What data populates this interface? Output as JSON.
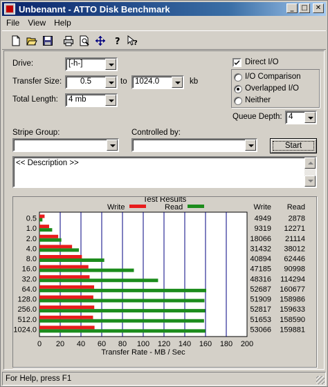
{
  "window": {
    "title": "Unbenannt - ATTO Disk Benchmark",
    "app_icon_text": "ATTO",
    "controls": {
      "minimize": "_",
      "maximize": "□",
      "close": "✕"
    }
  },
  "menu": [
    "File",
    "View",
    "Help"
  ],
  "toolbar": [
    "new-icon",
    "open-icon",
    "save-icon",
    "print-icon",
    "print-preview-icon",
    "move-icon",
    "help-icon",
    "context-help-icon"
  ],
  "form": {
    "drive": {
      "label": "Drive:",
      "value": "[-h-]"
    },
    "transfer_size": {
      "label": "Transfer Size:",
      "from": "0.5",
      "to_label": "to",
      "to": "1024.0",
      "unit": "kb"
    },
    "total_length": {
      "label": "Total Length:",
      "value": "4 mb"
    },
    "direct_io": {
      "label": "Direct I/O",
      "checked": true
    },
    "io_mode": {
      "options": [
        "I/O Comparison",
        "Overlapped I/O",
        "Neither"
      ],
      "selected": 1
    },
    "queue_depth": {
      "label": "Queue Depth:",
      "value": "4"
    },
    "stripe_group": {
      "label": "Stripe Group:",
      "value": ""
    },
    "controlled_by": {
      "label": "Controlled by:",
      "value": ""
    },
    "start_button": "Start",
    "description": "<< Description >>"
  },
  "results": {
    "title": "Test Results",
    "legend": {
      "write": "Write",
      "read": "Read"
    },
    "column_headers": {
      "write": "Write",
      "read": "Read"
    },
    "colors": {
      "write": "#e81c1c",
      "read": "#1c8c1c",
      "grid": "#000080"
    }
  },
  "chart_data": {
    "type": "bar",
    "orientation": "horizontal",
    "categories": [
      "0.5",
      "1.0",
      "2.0",
      "4.0",
      "8.0",
      "16.0",
      "32.0",
      "64.0",
      "128.0",
      "256.0",
      "512.0",
      "1024.0"
    ],
    "series": [
      {
        "name": "Write",
        "values": [
          4949,
          9319,
          18066,
          31432,
          40894,
          47185,
          48316,
          52687,
          51909,
          52817,
          51653,
          53066
        ]
      },
      {
        "name": "Read",
        "values": [
          2878,
          12271,
          21114,
          38012,
          62446,
          90998,
          114294,
          160677,
          158986,
          159633,
          158590,
          159881
        ]
      }
    ],
    "xlabel": "Transfer Rate - MB / Sec",
    "xlim": [
      0,
      200
    ],
    "xticks": [
      0,
      20,
      40,
      60,
      80,
      100,
      120,
      140,
      160,
      180,
      200
    ],
    "grid": true
  },
  "status": {
    "text": "For Help, press F1"
  }
}
